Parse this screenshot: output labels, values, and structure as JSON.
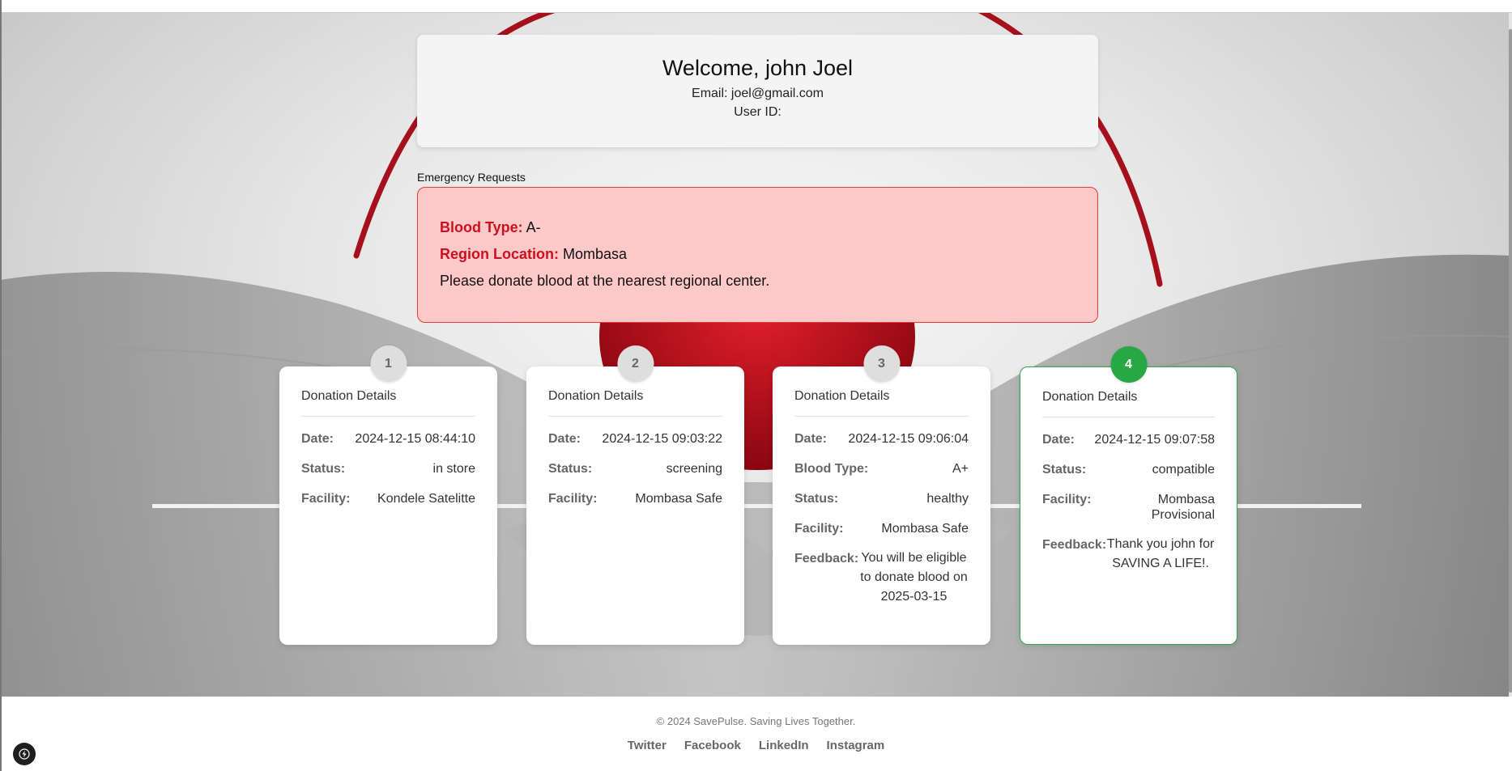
{
  "welcome": {
    "title": "Welcome, john Joel",
    "email": "Email: joel@gmail.com",
    "user_id": "User ID:"
  },
  "emergency": {
    "section_label": "Emergency Requests",
    "blood_type_label": "Blood Type:",
    "blood_type": "A-",
    "region_label": "Region Location:",
    "region": "Mombasa",
    "message": "Please donate blood at the nearest regional center."
  },
  "donations": [
    {
      "number": "1",
      "title": "Donation Details",
      "date_label": "Date:",
      "date": "2024-12-15 08:44:10",
      "status_label": "Status:",
      "status": "in store",
      "facility_label": "Facility:",
      "facility": "Kondele Satelitte"
    },
    {
      "number": "2",
      "title": "Donation Details",
      "date_label": "Date:",
      "date": "2024-12-15 09:03:22",
      "status_label": "Status:",
      "status": "screening",
      "facility_label": "Facility:",
      "facility": "Mombasa Safe"
    },
    {
      "number": "3",
      "title": "Donation Details",
      "date_label": "Date:",
      "date": "2024-12-15 09:06:04",
      "blood_type_label": "Blood Type:",
      "blood_type": "A+",
      "status_label": "Status:",
      "status": "healthy",
      "facility_label": "Facility:",
      "facility": "Mombasa Safe",
      "feedback_label": "Feedback:",
      "feedback": "You will be eligible to donate blood on 2025-03-15"
    },
    {
      "number": "4",
      "title": "Donation Details",
      "date_label": "Date:",
      "date": "2024-12-15 09:07:58",
      "status_label": "Status:",
      "status": "compatible",
      "facility_label": "Facility:",
      "facility": "Mombasa Provisional",
      "feedback_label": "Feedback:",
      "feedback": "Thank you john for SAVING A LIFE!."
    }
  ],
  "footer": {
    "copyright": "© 2024 SavePulse. Saving Lives Together.",
    "links": [
      "Twitter",
      "Facebook",
      "LinkedIn",
      "Instagram"
    ]
  },
  "colors": {
    "accent_red": "#cc1020",
    "emergency_bg": "#ffc9c9",
    "active_green": "#28a745"
  },
  "icons": {
    "dev_badge": "bolt-icon"
  }
}
